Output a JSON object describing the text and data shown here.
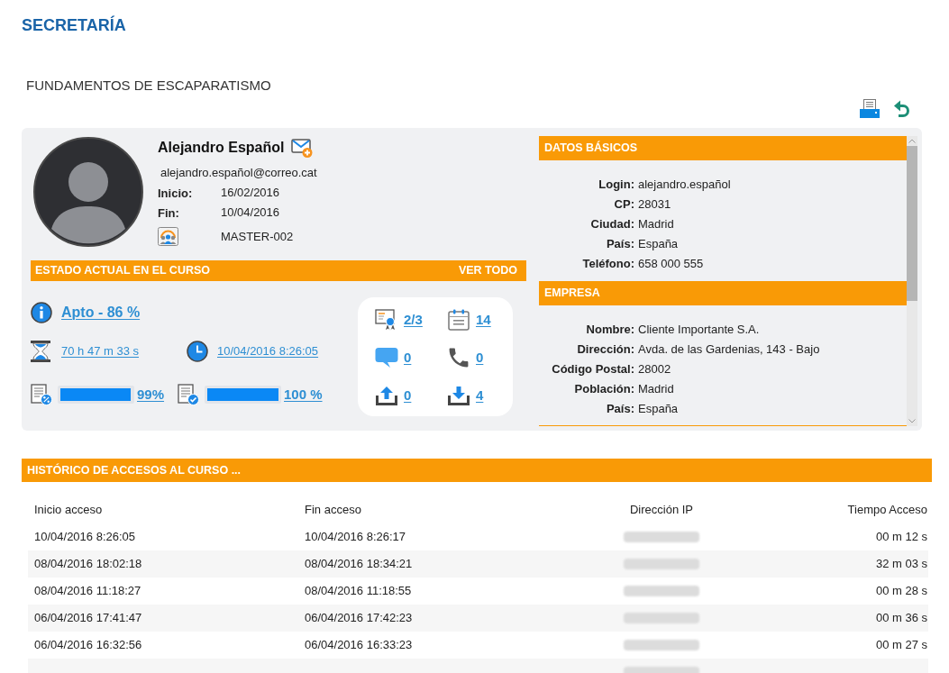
{
  "page": {
    "title": "SECRETARÍA",
    "course": "FUNDAMENTOS DE ESCAPARATISMO"
  },
  "student": {
    "name": "Alejandro Español",
    "email": "alejandro.español@correo.cat",
    "dates": [
      {
        "label": "Inicio:",
        "value": "16/02/2016"
      },
      {
        "label": "Fin:",
        "value": "10/04/2016"
      }
    ],
    "group": "MASTER-002"
  },
  "status": {
    "title": "ESTADO ACTUAL EN EL CURSO",
    "link": "VER TODO",
    "result": "Apto - 86 %",
    "time": "70 h 47 m 33 s",
    "last_access": "10/04/2016 8:26:05",
    "progress": [
      {
        "kind": "percent",
        "level": 0.99,
        "reading": "99%"
      },
      {
        "kind": "check",
        "level": 1,
        "reading": "100 %"
      }
    ]
  },
  "counters": [
    {
      "kind": "certificate",
      "value": "2/3"
    },
    {
      "kind": "calendar",
      "value": "14"
    },
    {
      "kind": "message",
      "value": "0"
    },
    {
      "kind": "phone",
      "value": "0"
    },
    {
      "kind": "upload",
      "value": "0"
    },
    {
      "kind": "download",
      "value": "4"
    }
  ],
  "basic_data": {
    "title": "DATOS BÁSICOS",
    "fields": [
      {
        "label": "Login:",
        "value": "alejandro.español"
      },
      {
        "label": "CP:",
        "value": "28031"
      },
      {
        "label": "Ciudad:",
        "value": "Madrid"
      },
      {
        "label": "País:",
        "value": "España"
      },
      {
        "label": "Teléfono:",
        "value": "658 000 555"
      }
    ]
  },
  "company": {
    "title": "EMPRESA",
    "fields": [
      {
        "label": "Nombre:",
        "value": "Cliente Importante S.A."
      },
      {
        "label": "Dirección:",
        "value": "Avda. de las Gardenias, 143 - Bajo"
      },
      {
        "label": "Código Postal:",
        "value": "28002"
      },
      {
        "label": "Población:",
        "value": "Madrid"
      },
      {
        "label": "País:",
        "value": "España"
      }
    ]
  },
  "access_history": {
    "title": "HISTÓRICO DE ACCESOS AL CURSO ...",
    "columns": [
      "Inicio acceso",
      "Fin acceso",
      "Dirección IP",
      "Tiempo Acceso"
    ],
    "rows": [
      {
        "start": "10/04/2016 8:26:05",
        "end": "10/04/2016 8:26:17",
        "duration": "00 m 12 s"
      },
      {
        "start": "08/04/2016 18:02:18",
        "end": "08/04/2016 18:34:21",
        "duration": "32 m 03 s"
      },
      {
        "start": "08/04/2016 11:18:27",
        "end": "08/04/2016 11:18:55",
        "duration": "00 m 28 s"
      },
      {
        "start": "06/04/2016 17:41:47",
        "end": "06/04/2016 17:42:23",
        "duration": "00 m 36 s"
      },
      {
        "start": "06/04/2016 16:32:56",
        "end": "06/04/2016 16:33:23",
        "duration": "00 m 27 s"
      }
    ]
  }
}
